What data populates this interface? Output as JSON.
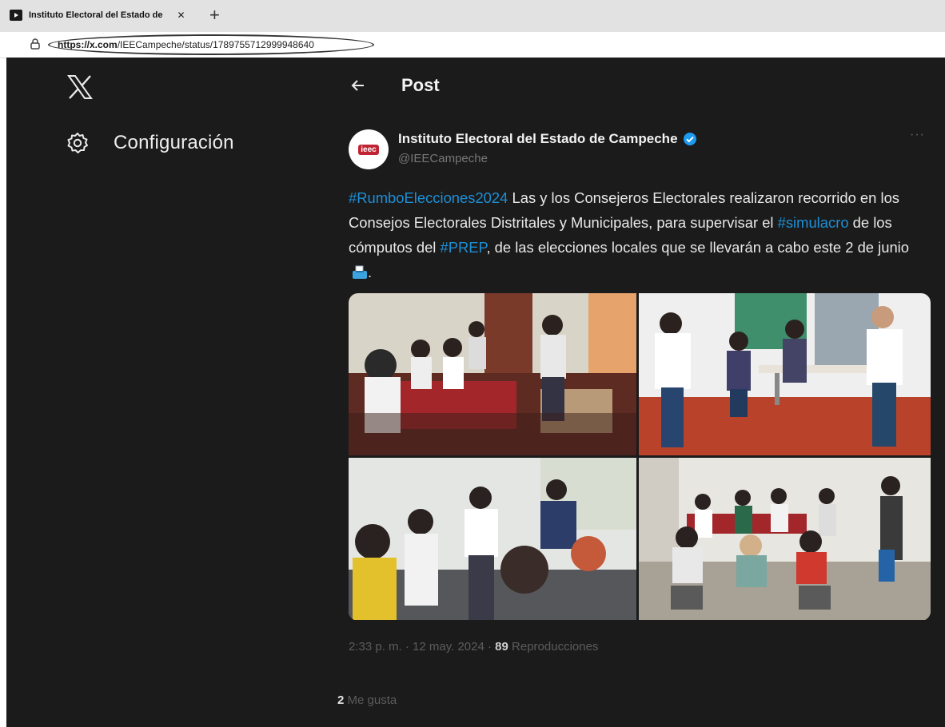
{
  "browser": {
    "tab_title": "Instituto Electoral del Estado de",
    "tab_close": "✕",
    "new_tab": "+",
    "url_scheme": "https://",
    "url_host": "x.com",
    "url_path": "/IEECampeche/status/1789755712999948640"
  },
  "sidebar": {
    "settings_label": "Configuración"
  },
  "post": {
    "title": "Post",
    "author_name": "Instituto Electoral del Estado de Campeche",
    "author_handle": "@IEECampeche",
    "avatar_text": "ieec",
    "more": "···",
    "text": {
      "hashtag_1": "#RumboElecciones2024",
      "part_1": " Las y los Consejeros Electorales realizaron recorrido en los Consejos Electorales Distritales y Municipales, para supervisar el ",
      "hashtag_2": "#simulacro",
      "part_2": " de los cómputos del ",
      "hashtag_3": "#PREP",
      "part_3": ", de las elecciones locales que se llevarán a cabo este 2 de junio",
      "part_4": "."
    },
    "time": "2:33 p. m.",
    "date": "12 may. 2024",
    "separator": "·",
    "views_count": "89",
    "views_label": "Reproducciones",
    "likes_count": "2",
    "likes_label": "Me gusta"
  },
  "colors": {
    "page_background": "#1b1b1b",
    "hashtag": "#1d8fd6",
    "verified": "#1d9bf0",
    "text": "#e8e8e8",
    "muted": "#5c5c5c"
  },
  "icons": [
    "favicon-icon",
    "close-icon",
    "plus-icon",
    "lock-icon",
    "x-logo-icon",
    "gear-icon",
    "back-arrow-icon",
    "verified-badge-icon",
    "more-icon",
    "ballot-box-icon"
  ]
}
